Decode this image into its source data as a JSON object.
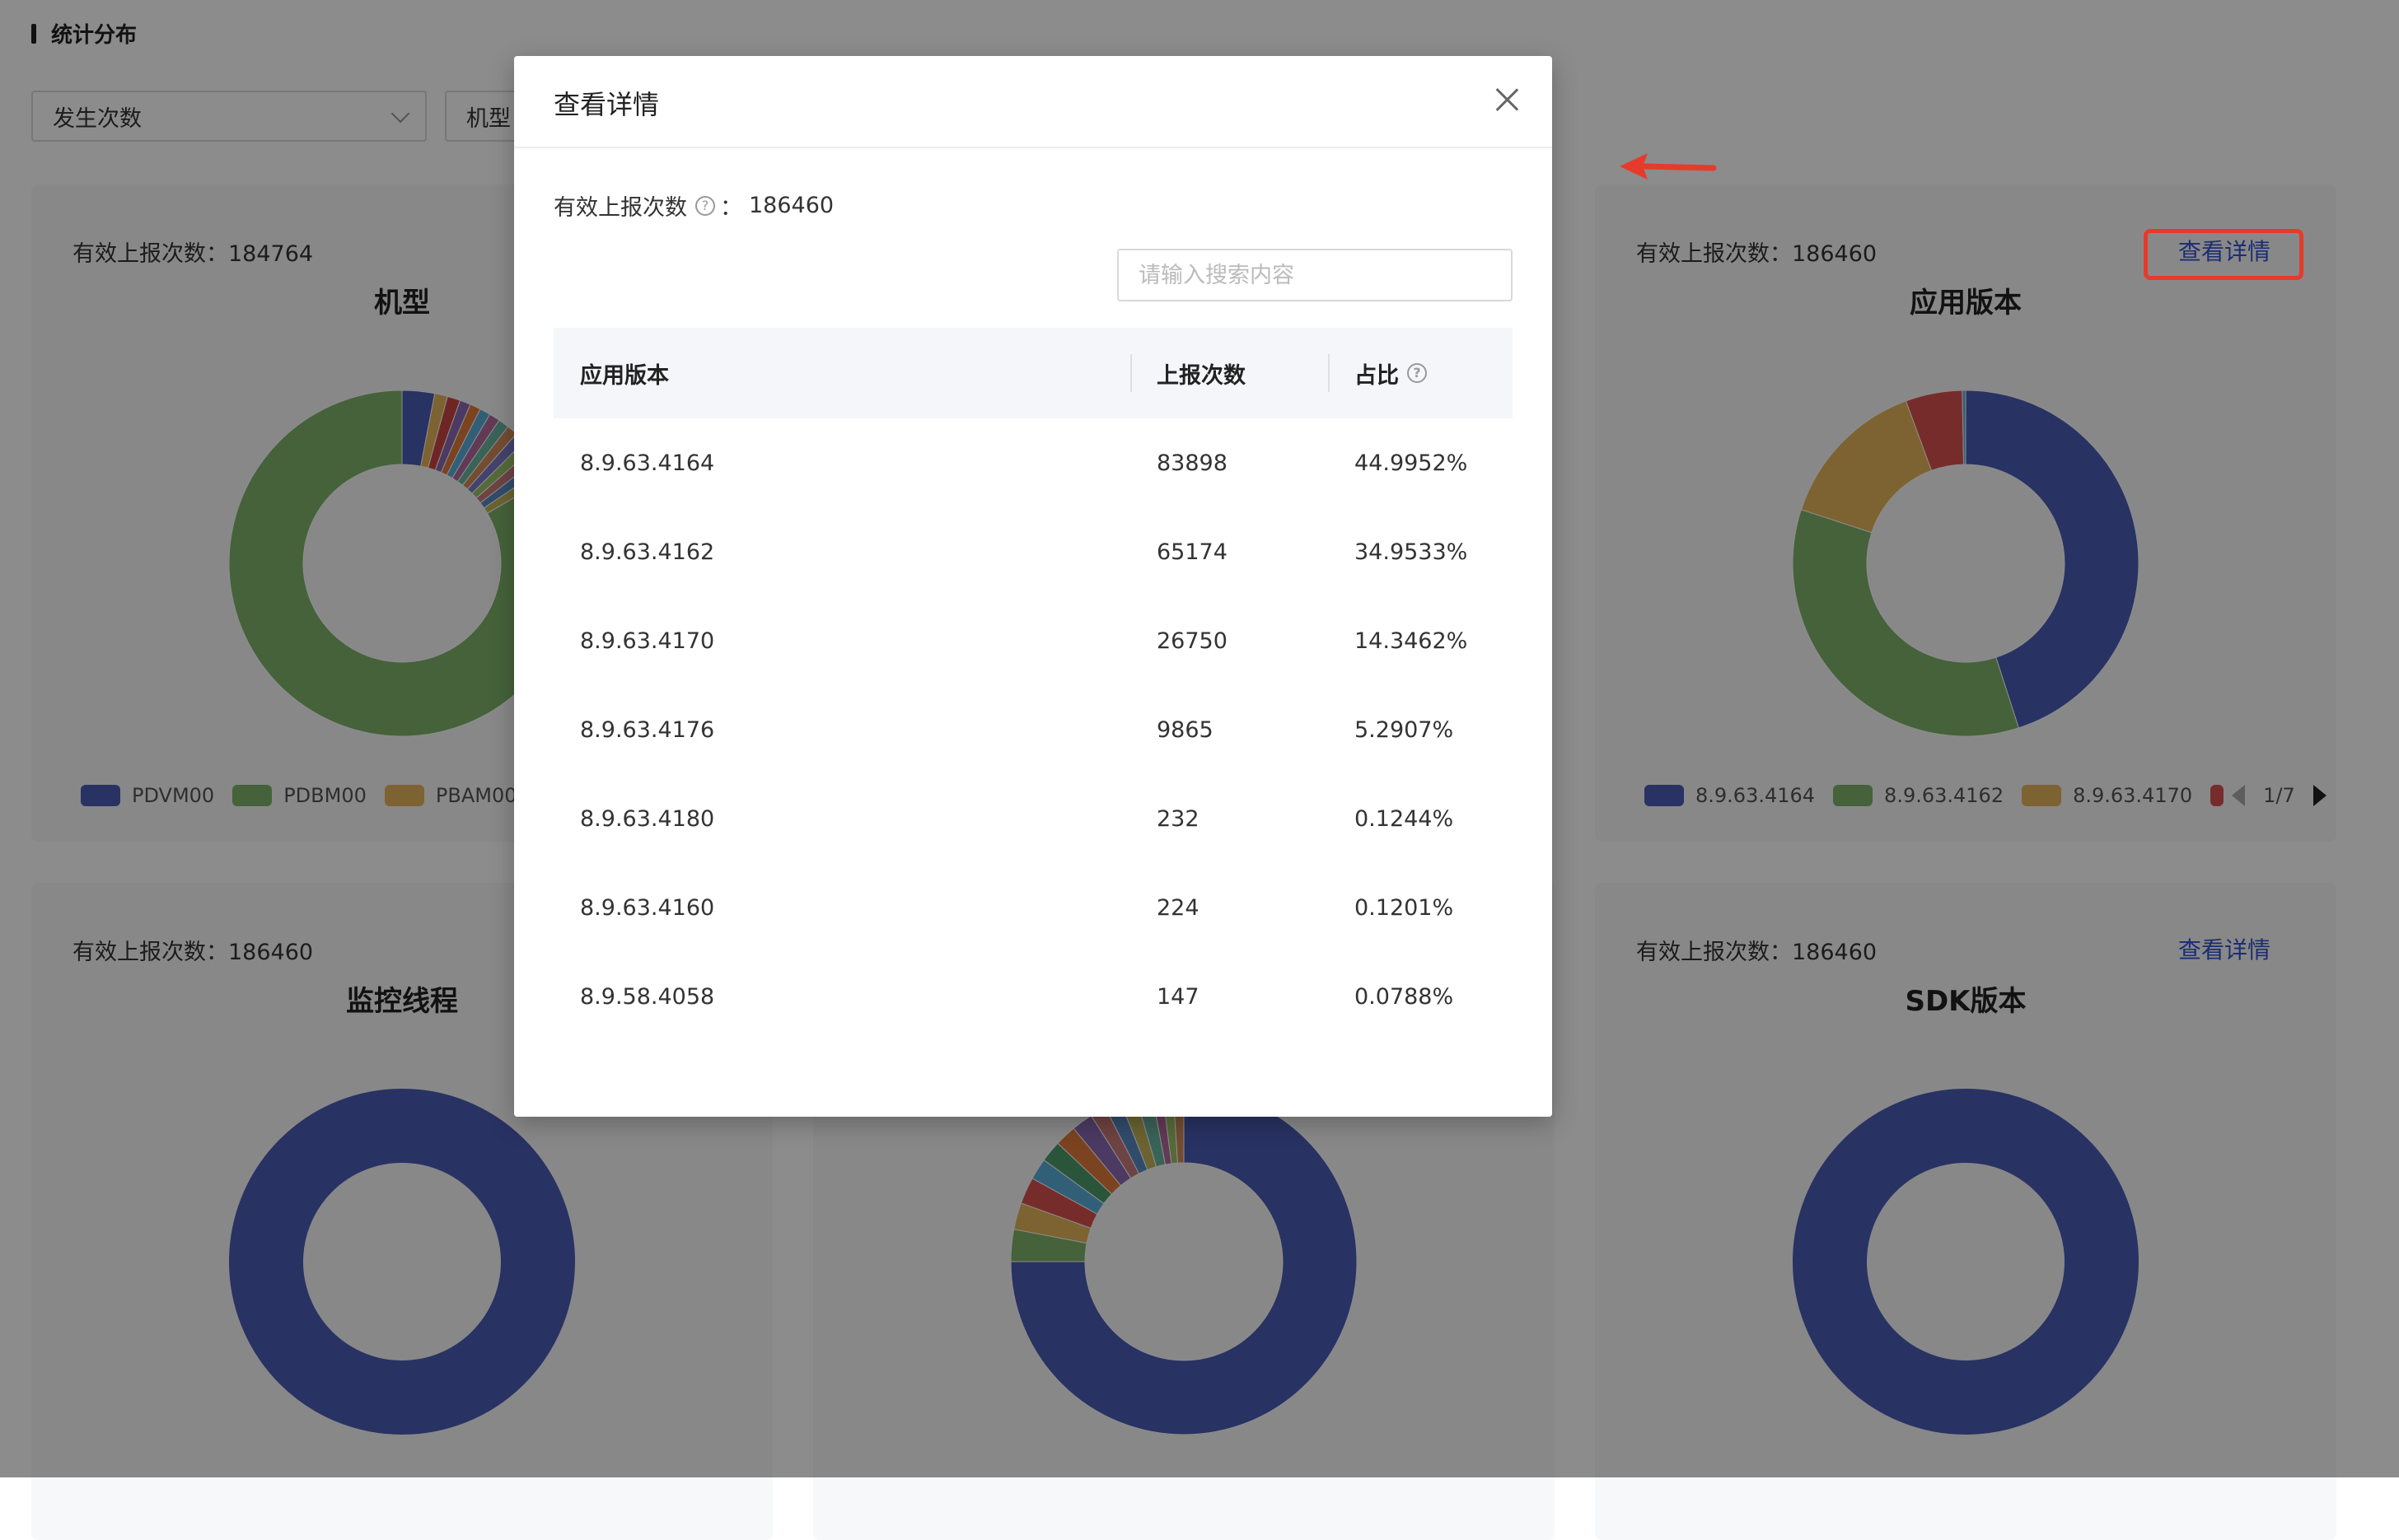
{
  "section_title": "统计分布",
  "filters": {
    "metric": "发生次数",
    "dimension": "机型"
  },
  "cards": {
    "model": {
      "count_label": "有效上报次数：",
      "count_value": "184764",
      "title": "机型",
      "legend": [
        {
          "label": "PDVM00",
          "color": "#4a5bb5"
        },
        {
          "label": "PDBM00",
          "color": "#7fb26a"
        },
        {
          "label": "PBAM00",
          "color": "#e3b559"
        }
      ],
      "slices": [
        {
          "value": 3,
          "color": "#4a5bb5"
        },
        {
          "value": 1.2,
          "color": "#e3b559"
        },
        {
          "value": 1.2,
          "color": "#c44"
        },
        {
          "value": 1,
          "color": "#8a6bb5"
        },
        {
          "value": 1,
          "color": "#e07b3a"
        },
        {
          "value": 1,
          "color": "#5aaedb"
        },
        {
          "value": 1,
          "color": "#b36b9c"
        },
        {
          "value": 1,
          "color": "#6bb5a0"
        },
        {
          "value": 1,
          "color": "#d48a5c"
        },
        {
          "value": 1,
          "color": "#7a7ac9"
        },
        {
          "value": 1,
          "color": "#9bc46b"
        },
        {
          "value": 1,
          "color": "#c97a7a"
        },
        {
          "value": 1,
          "color": "#5a8bc4"
        },
        {
          "value": 1,
          "color": "#c4b45a"
        },
        {
          "value": 82.6,
          "color": "#7fb26a"
        }
      ]
    },
    "app_version": {
      "count_label": "有效上报次数：",
      "count_value": "186460",
      "title": "应用版本",
      "detail_link": "查看详情",
      "legend": [
        {
          "label": "8.9.63.4164",
          "color": "#4a5bb5"
        },
        {
          "label": "8.9.63.4162",
          "color": "#7fb26a"
        },
        {
          "label": "8.9.63.4170",
          "color": "#e3b559"
        },
        {
          "label": "",
          "color": "#d95050"
        }
      ],
      "pager": "1/7",
      "slices": [
        {
          "value": 44.9952,
          "color": "#4a5bb5"
        },
        {
          "value": 34.9533,
          "color": "#7fb26a"
        },
        {
          "value": 14.3462,
          "color": "#e3b559"
        },
        {
          "value": 5.2907,
          "color": "#d95050"
        },
        {
          "value": 0.3146,
          "color": "#5aaedb"
        }
      ]
    },
    "thread": {
      "count_label": "有效上报次数：",
      "count_value": "186460",
      "title": "监控线程",
      "slices": [
        {
          "value": 100,
          "color": "#4a5bb5"
        }
      ]
    },
    "middle": {
      "slices": [
        {
          "value": 75,
          "color": "#4a5bb5"
        },
        {
          "value": 3,
          "color": "#7fb26a"
        },
        {
          "value": 2.5,
          "color": "#e3b559"
        },
        {
          "value": 2.5,
          "color": "#d95050"
        },
        {
          "value": 2,
          "color": "#5aaedb"
        },
        {
          "value": 2,
          "color": "#4d9b6a"
        },
        {
          "value": 2,
          "color": "#e07b3a"
        },
        {
          "value": 2,
          "color": "#8a6bb5"
        },
        {
          "value": 1.5,
          "color": "#c97a7a"
        },
        {
          "value": 1.5,
          "color": "#5a8bc4"
        },
        {
          "value": 1.5,
          "color": "#c4b45a"
        },
        {
          "value": 1.5,
          "color": "#6bb5a0"
        },
        {
          "value": 1,
          "color": "#b36b9c"
        },
        {
          "value": 1,
          "color": "#9bc46b"
        },
        {
          "value": 1,
          "color": "#d48a5c"
        }
      ]
    },
    "sdk_version": {
      "count_label": "有效上报次数：",
      "count_value": "186460",
      "title": "SDK版本",
      "detail_link": "查看详情",
      "slices": [
        {
          "value": 100,
          "color": "#4a5bb5"
        }
      ]
    }
  },
  "modal": {
    "title": "查看详情",
    "count_label": "有效上报次数",
    "count_value": "186460",
    "search_placeholder": "请输入搜索内容",
    "columns": [
      "应用版本",
      "上报次数",
      "占比"
    ],
    "rows": [
      {
        "version": "8.9.63.4164",
        "count": "83898",
        "ratio": "44.9952%"
      },
      {
        "version": "8.9.63.4162",
        "count": "65174",
        "ratio": "34.9533%"
      },
      {
        "version": "8.9.63.4170",
        "count": "26750",
        "ratio": "14.3462%"
      },
      {
        "version": "8.9.63.4176",
        "count": "9865",
        "ratio": "5.2907%"
      },
      {
        "version": "8.9.63.4180",
        "count": "232",
        "ratio": "0.1244%"
      },
      {
        "version": "8.9.63.4160",
        "count": "224",
        "ratio": "0.1201%"
      },
      {
        "version": "8.9.58.4058",
        "count": "147",
        "ratio": "0.0788%"
      }
    ]
  }
}
